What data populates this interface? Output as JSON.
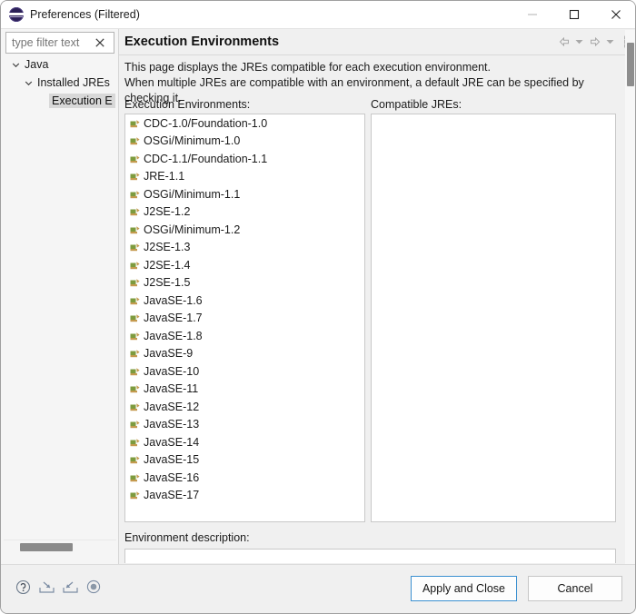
{
  "window": {
    "title": "Preferences (Filtered)",
    "icon": "eclipse-icon",
    "controls": {
      "minimize": "minimize-icon",
      "maximize": "maximize-icon",
      "close": "close-icon"
    }
  },
  "filter": {
    "placeholder": "type filter text",
    "value": "",
    "clear_label": "✕"
  },
  "tree": {
    "items": [
      {
        "label": "Java",
        "depth": 1,
        "expanded": true,
        "selected": false
      },
      {
        "label": "Installed JREs",
        "depth": 2,
        "expanded": true,
        "selected": false
      },
      {
        "label": "Execution E",
        "depth": 3,
        "expanded": null,
        "selected": true
      }
    ]
  },
  "page": {
    "title": "Execution Environments",
    "description_lines": [
      "This page displays the JREs compatible for each execution environment.",
      "When multiple JREs are compatible with an environment, a default JRE can be specified by checking it."
    ],
    "toolbar": [
      {
        "name": "back-arrow-icon",
        "glyph": "⇦"
      },
      {
        "name": "back-dropdown-icon",
        "glyph": "▾"
      },
      {
        "name": "forward-arrow-icon",
        "glyph": "⇨"
      },
      {
        "name": "forward-dropdown-icon",
        "glyph": "▾"
      },
      {
        "name": "view-menu-icon",
        "glyph": "⋮"
      }
    ]
  },
  "lists": {
    "execution_environments": {
      "label": "Execution Environments:",
      "items": [
        "CDC-1.0/Foundation-1.0",
        "OSGi/Minimum-1.0",
        "CDC-1.1/Foundation-1.1",
        "JRE-1.1",
        "OSGi/Minimum-1.1",
        "J2SE-1.2",
        "OSGi/Minimum-1.2",
        "J2SE-1.3",
        "J2SE-1.4",
        "J2SE-1.5",
        "JavaSE-1.6",
        "JavaSE-1.7",
        "JavaSE-1.8",
        "JavaSE-9",
        "JavaSE-10",
        "JavaSE-11",
        "JavaSE-12",
        "JavaSE-13",
        "JavaSE-14",
        "JavaSE-15",
        "JavaSE-16",
        "JavaSE-17"
      ]
    },
    "compatible_jres": {
      "label": "Compatible JREs:",
      "items": []
    }
  },
  "environment_description": {
    "label": "Environment description:",
    "value": ""
  },
  "bottom": {
    "icons": [
      {
        "name": "help-icon",
        "glyph": "?"
      },
      {
        "name": "import-icon",
        "glyph": "import"
      },
      {
        "name": "export-icon",
        "glyph": "export"
      },
      {
        "name": "restore-defaults-icon",
        "glyph": "circle"
      }
    ],
    "buttons": [
      {
        "name": "apply-and-close-button",
        "label": "Apply and Close",
        "focused": true
      },
      {
        "name": "cancel-button",
        "label": "Cancel",
        "focused": false
      }
    ]
  },
  "colors": {
    "accent": "#3a8fd0",
    "selection": "#d8d8d8",
    "panel": "#f0f0f0",
    "list_bg": "#ffffff",
    "icon_green": "#7d9b3e",
    "icon_tan": "#c49a4e"
  }
}
